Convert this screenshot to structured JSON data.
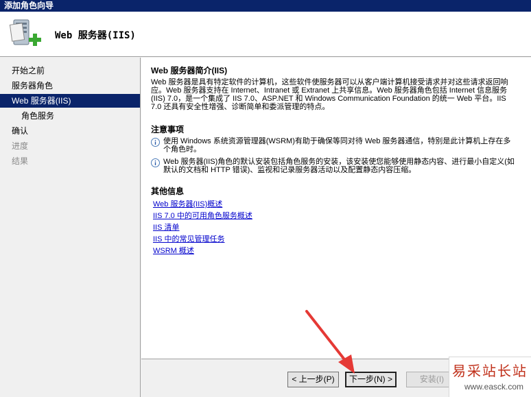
{
  "window": {
    "title": "添加角色向导"
  },
  "header": {
    "title": "Web 服务器(IIS)",
    "icon": "server-role-add-icon"
  },
  "sidebar": {
    "items": [
      {
        "label": "开始之前",
        "level": 0,
        "state": "normal"
      },
      {
        "label": "服务器角色",
        "level": 0,
        "state": "normal"
      },
      {
        "label": "Web 服务器(IIS)",
        "level": 0,
        "state": "selected"
      },
      {
        "label": "角色服务",
        "level": 1,
        "state": "normal"
      },
      {
        "label": "确认",
        "level": 0,
        "state": "normal"
      },
      {
        "label": "进度",
        "level": 0,
        "state": "disabled"
      },
      {
        "label": "结果",
        "level": 0,
        "state": "disabled"
      }
    ]
  },
  "main": {
    "intro_heading": "Web 服务器简介(IIS)",
    "intro_text": "Web 服务器是具有特定软件的计算机，这些软件使服务器可以从客户端计算机接受请求并对这些请求返回响应。Web 服务器支持在 Internet、Intranet 或 Extranet 上共享信息。Web 服务器角色包括 Internet 信息服务(IIS) 7.0，是一个集成了 IIS 7.0、ASP.NET 和 Windows Communication Foundation 的统一 Web 平台。IIS 7.0 还具有安全性增强、诊断简单和委派管理的特点。",
    "notes_heading": "注意事项",
    "notes": [
      "使用 Windows 系统资源管理器(WSRM)有助于确保等同对待 Web 服务器通信，特别是此计算机上存在多个角色时。",
      "Web 服务器(IIS)角色的默认安装包括角色服务的安装，该安装使您能够使用静态内容、进行最小自定义(如默认的文档和 HTTP 错误)、监视和记录服务器活动以及配置静态内容压缩。"
    ],
    "more_heading": "其他信息",
    "links": [
      "Web 服务器(IIS)概述",
      "IIS 7.0 中的可用角色服务概述",
      "IIS 清单",
      "IIS 中的常见管理任务",
      "WSRM 概述"
    ]
  },
  "footer": {
    "prev_label": "< 上一步(P)",
    "next_label": "下一步(N) >",
    "install_label": "安装(I)"
  },
  "watermark": {
    "text": "易采站长站",
    "url": "www.easck.com"
  },
  "colors": {
    "titlebar": "#0a246a",
    "selected": "#0a246a",
    "link": "#0000cc",
    "annotation_arrow": "#e53935"
  }
}
